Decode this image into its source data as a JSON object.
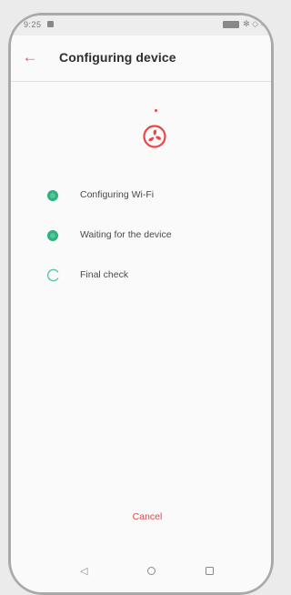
{
  "status_bar": {
    "time": "9:25",
    "status_glyphs": "✻ ◇ ○"
  },
  "header": {
    "back_icon": "←",
    "title": "Configuring device"
  },
  "steps": [
    {
      "label": "Configuring Wi-Fi",
      "state": "done"
    },
    {
      "label": "Waiting for the device",
      "state": "done"
    },
    {
      "label": "Final check",
      "state": "in-progress"
    }
  ],
  "actions": {
    "cancel_label": "Cancel"
  },
  "nav": {
    "back_glyph": "◁"
  },
  "colors": {
    "accent": "#e8505b",
    "done": "#2fb07d"
  }
}
